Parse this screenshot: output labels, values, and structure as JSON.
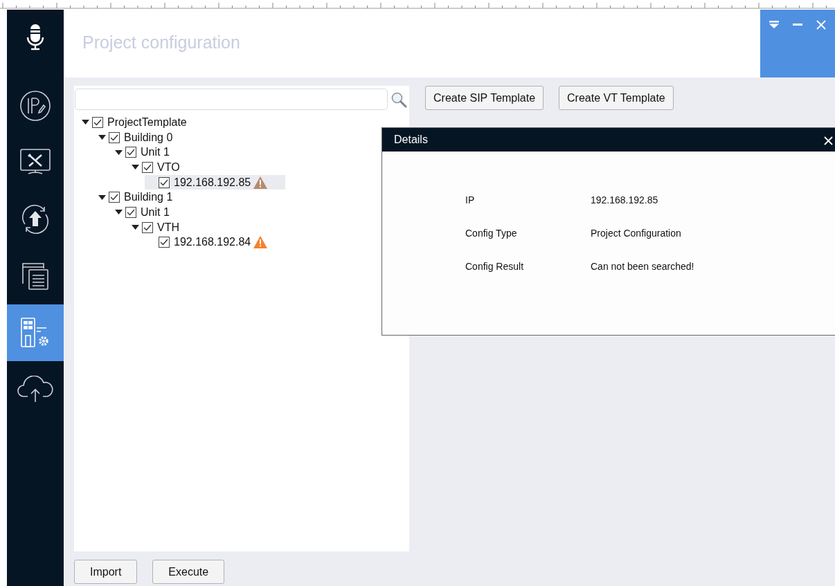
{
  "app_title": "Project configuration",
  "window_controls": [
    {
      "kind": "dropdown"
    },
    {
      "kind": "minimize"
    },
    {
      "kind": "close"
    }
  ],
  "sidebar": {
    "items": [
      {
        "kind": "ip",
        "selected": false
      },
      {
        "kind": "tools",
        "selected": false
      },
      {
        "kind": "upgrade",
        "selected": false
      },
      {
        "kind": "windows",
        "selected": false
      },
      {
        "kind": "building",
        "selected": true
      },
      {
        "kind": "cloud",
        "selected": false
      }
    ]
  },
  "template_buttons": [
    "Create SIP Template",
    "Create VT Template"
  ],
  "tree": [
    {
      "label": "ProjectTemplate",
      "checked": true,
      "expanded": true,
      "children": [
        {
          "label": "Building 0",
          "checked": true,
          "expanded": true,
          "children": [
            {
              "label": "Unit 1",
              "checked": true,
              "expanded": true,
              "children": [
                {
                  "label": "VTO",
                  "checked": true,
                  "expanded": true,
                  "children": [
                    {
                      "label": "192.168.192.85",
                      "checked": true,
                      "selected": true,
                      "color": "#b58a6e"
                    }
                  ]
                }
              ]
            }
          ]
        },
        {
          "label": "Building 1",
          "checked": true,
          "expanded": true,
          "children": [
            {
              "label": "Unit 1",
              "checked": true,
              "expanded": true,
              "children": [
                {
                  "label": "VTH",
                  "checked": true,
                  "expanded": true,
                  "children": [
                    {
                      "label": "192.168.192.84",
                      "checked": true,
                      "selected": false,
                      "color": "#f5822a"
                    }
                  ]
                }
              ]
            }
          ]
        }
      ]
    }
  ],
  "details": {
    "title": "Details",
    "rows": [
      {
        "label": "IP",
        "value": "192.168.192.85"
      },
      {
        "label": "Config Type",
        "value": "Project Configuration"
      },
      {
        "label": "Config Result",
        "value": "Can not been searched!"
      }
    ]
  },
  "footer_buttons": [
    "Import",
    "Execute"
  ]
}
